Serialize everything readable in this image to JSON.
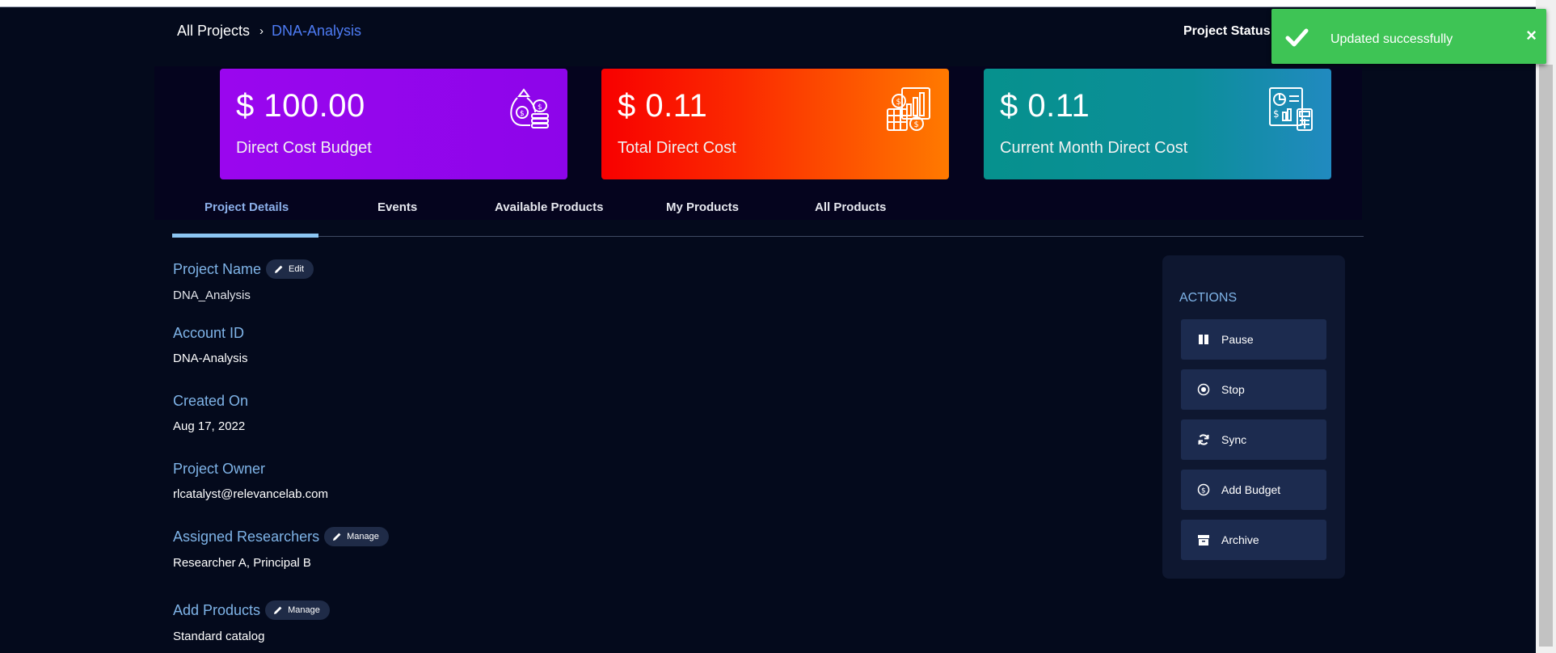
{
  "breadcrumb": {
    "root": "All Projects",
    "separator": "›",
    "current": "DNA-Analysis"
  },
  "header": {
    "status_label": "Project Status :"
  },
  "toast": {
    "message": "Updated successfully",
    "close": "×",
    "icon": "check-icon",
    "color": "#3ec455"
  },
  "cards": [
    {
      "amount": "$ 100.00",
      "label": "Direct Cost Budget",
      "icon": "money-bag-icon"
    },
    {
      "amount": "$ 0.11",
      "label": "Total Direct Cost",
      "icon": "cost-report-icon"
    },
    {
      "amount": "$ 0.11",
      "label": "Current Month Direct Cost",
      "icon": "monthly-report-icon"
    }
  ],
  "tabs": [
    {
      "label": "Project Details",
      "active": true
    },
    {
      "label": "Events"
    },
    {
      "label": "Available Products"
    },
    {
      "label": "My Products"
    },
    {
      "label": "All Products"
    }
  ],
  "details": {
    "project_name": {
      "label": "Project Name",
      "value": "DNA_Analysis",
      "action": "Edit"
    },
    "account_id": {
      "label": "Account ID",
      "value": "DNA-Analysis"
    },
    "created_on": {
      "label": "Created On",
      "value": "Aug 17, 2022"
    },
    "project_owner": {
      "label": "Project Owner",
      "value": "rlcatalyst@relevancelab.com"
    },
    "assigned_researchers": {
      "label": "Assigned Researchers",
      "value": "Researcher A, Principal B",
      "action": "Manage"
    },
    "add_products": {
      "label": "Add Products",
      "value": "Standard catalog",
      "action": "Manage"
    }
  },
  "actions": {
    "title": "ACTIONS",
    "buttons": [
      {
        "label": "Pause",
        "icon": "pause-icon"
      },
      {
        "label": "Stop",
        "icon": "stop-icon"
      },
      {
        "label": "Sync",
        "icon": "sync-icon"
      },
      {
        "label": "Add Budget",
        "icon": "dollar-circle-icon"
      },
      {
        "label": "Archive",
        "icon": "archive-icon"
      }
    ]
  },
  "colors": {
    "background": "#040a1c",
    "accent_blue": "#7fb4e8",
    "link": "#4d7bf3"
  }
}
